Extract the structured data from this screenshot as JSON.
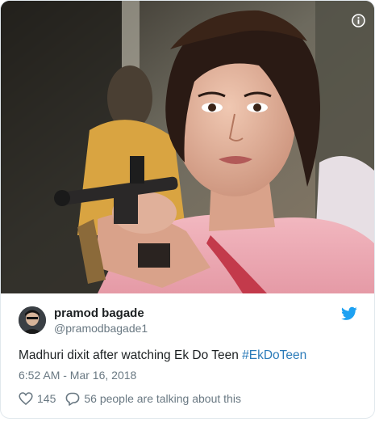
{
  "tweet": {
    "display_name": "pramod bagade",
    "handle": "@pramodbagade1",
    "text": "Madhuri dixit after watching Ek Do Teen ",
    "hashtag": "#EkDoTeen",
    "timestamp": "6:52 AM - Mar 16, 2018",
    "like_count": "145",
    "reply_text": "56 people are talking about this"
  },
  "icons": {
    "info": "info-icon",
    "brand": "twitter-bird-icon",
    "like": "heart-icon",
    "reply": "speech-bubble-icon"
  },
  "colors": {
    "link": "#2b7bb9",
    "brand": "#1da1f2",
    "secondary_text": "#697882",
    "primary_text": "#1c2022"
  }
}
